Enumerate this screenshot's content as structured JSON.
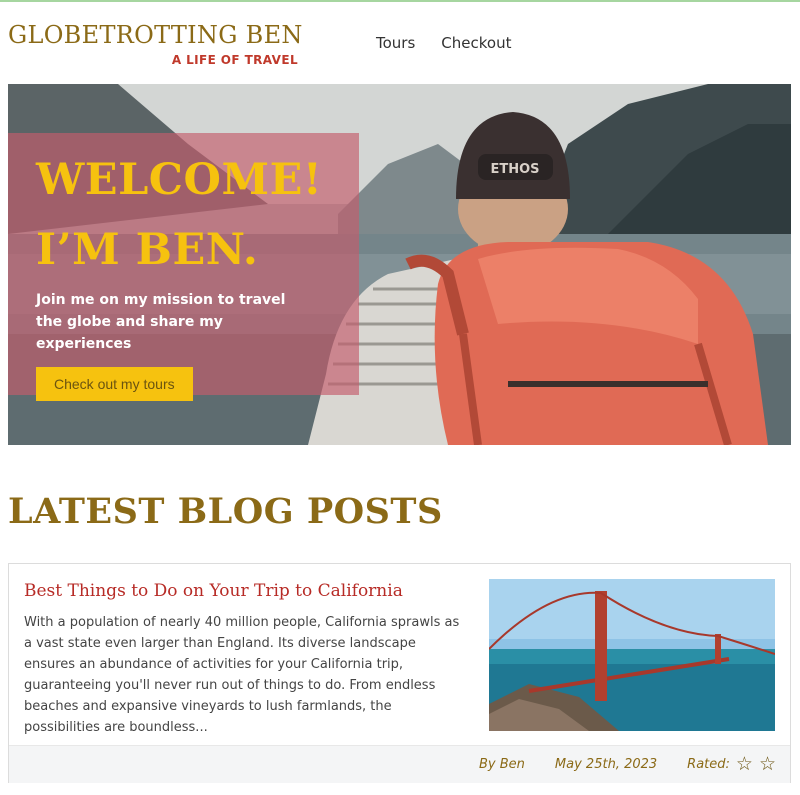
{
  "header": {
    "brand_title": "GLOBETROTTING BEN",
    "brand_tagline": "A LIFE OF TRAVEL",
    "nav": [
      {
        "label": "Tours"
      },
      {
        "label": "Checkout"
      }
    ]
  },
  "hero": {
    "line1": "WELCOME!",
    "line2": "I’M BEN.",
    "subtitle": "Join me on my mission to travel the globe and share my experiences",
    "cta_label": "Check out my tours",
    "cap_text": "ETHOS"
  },
  "blog": {
    "section_title": "LATEST BLOG POSTS",
    "posts": [
      {
        "title": "Best Things to Do on Your Trip to California",
        "excerpt": "With a population of nearly 40 million people, California sprawls as a vast state even larger than England. Its diverse landscape ensures an abundance of activities for your California trip, guaranteeing you'll never run out of things to do. From endless beaches and expansive vineyards to lush farmlands, the possibilities are boundless...",
        "author": "By Ben",
        "date": "May 25th, 2023",
        "rated_label": "Rated:",
        "star_icon": "star-outline-icon",
        "stars_shown": 2
      }
    ]
  },
  "colors": {
    "brand_gold": "#8b6a17",
    "accent_red": "#c0392b",
    "cta_yellow": "#f6c20f",
    "panel_pink": "#c45c6c"
  }
}
